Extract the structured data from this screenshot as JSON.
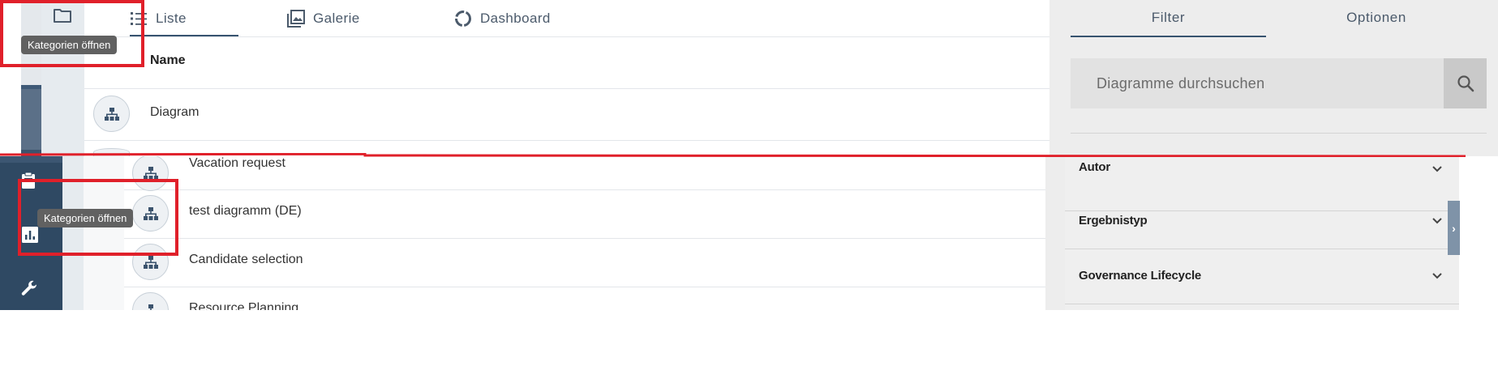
{
  "tooltip": {
    "label": "Kategorien öffnen"
  },
  "tabs": {
    "liste": "Liste",
    "galerie": "Galerie",
    "dashboard": "Dashboard"
  },
  "list": {
    "header_name": "Name",
    "rows": [
      "Diagram",
      "Vacation request",
      "test diagramm (DE)",
      "Candidate selection",
      "Resource Planning"
    ]
  },
  "filter_panel": {
    "tab_filter": "Filter",
    "tab_options": "Optionen",
    "search_placeholder": "Diagramme durchsuchen",
    "accordions": [
      "Autor",
      "Ergebnistyp",
      "Governance Lifecycle"
    ]
  },
  "icons": {
    "folder": "folder-icon",
    "list": "list-icon",
    "gallery": "gallery-icon",
    "dashboard": "dashboard-icon",
    "diagram": "diagram-icon",
    "search": "search-icon",
    "clipboard": "clipboard-icon",
    "chart": "bar-chart-icon",
    "wrench": "wrench-icon",
    "chevron": "chevron-down-icon"
  },
  "colors": {
    "primary": "#37536f",
    "sidebar": "#2f4963",
    "annotation": "#e0202a",
    "tooltip": "#616161"
  }
}
